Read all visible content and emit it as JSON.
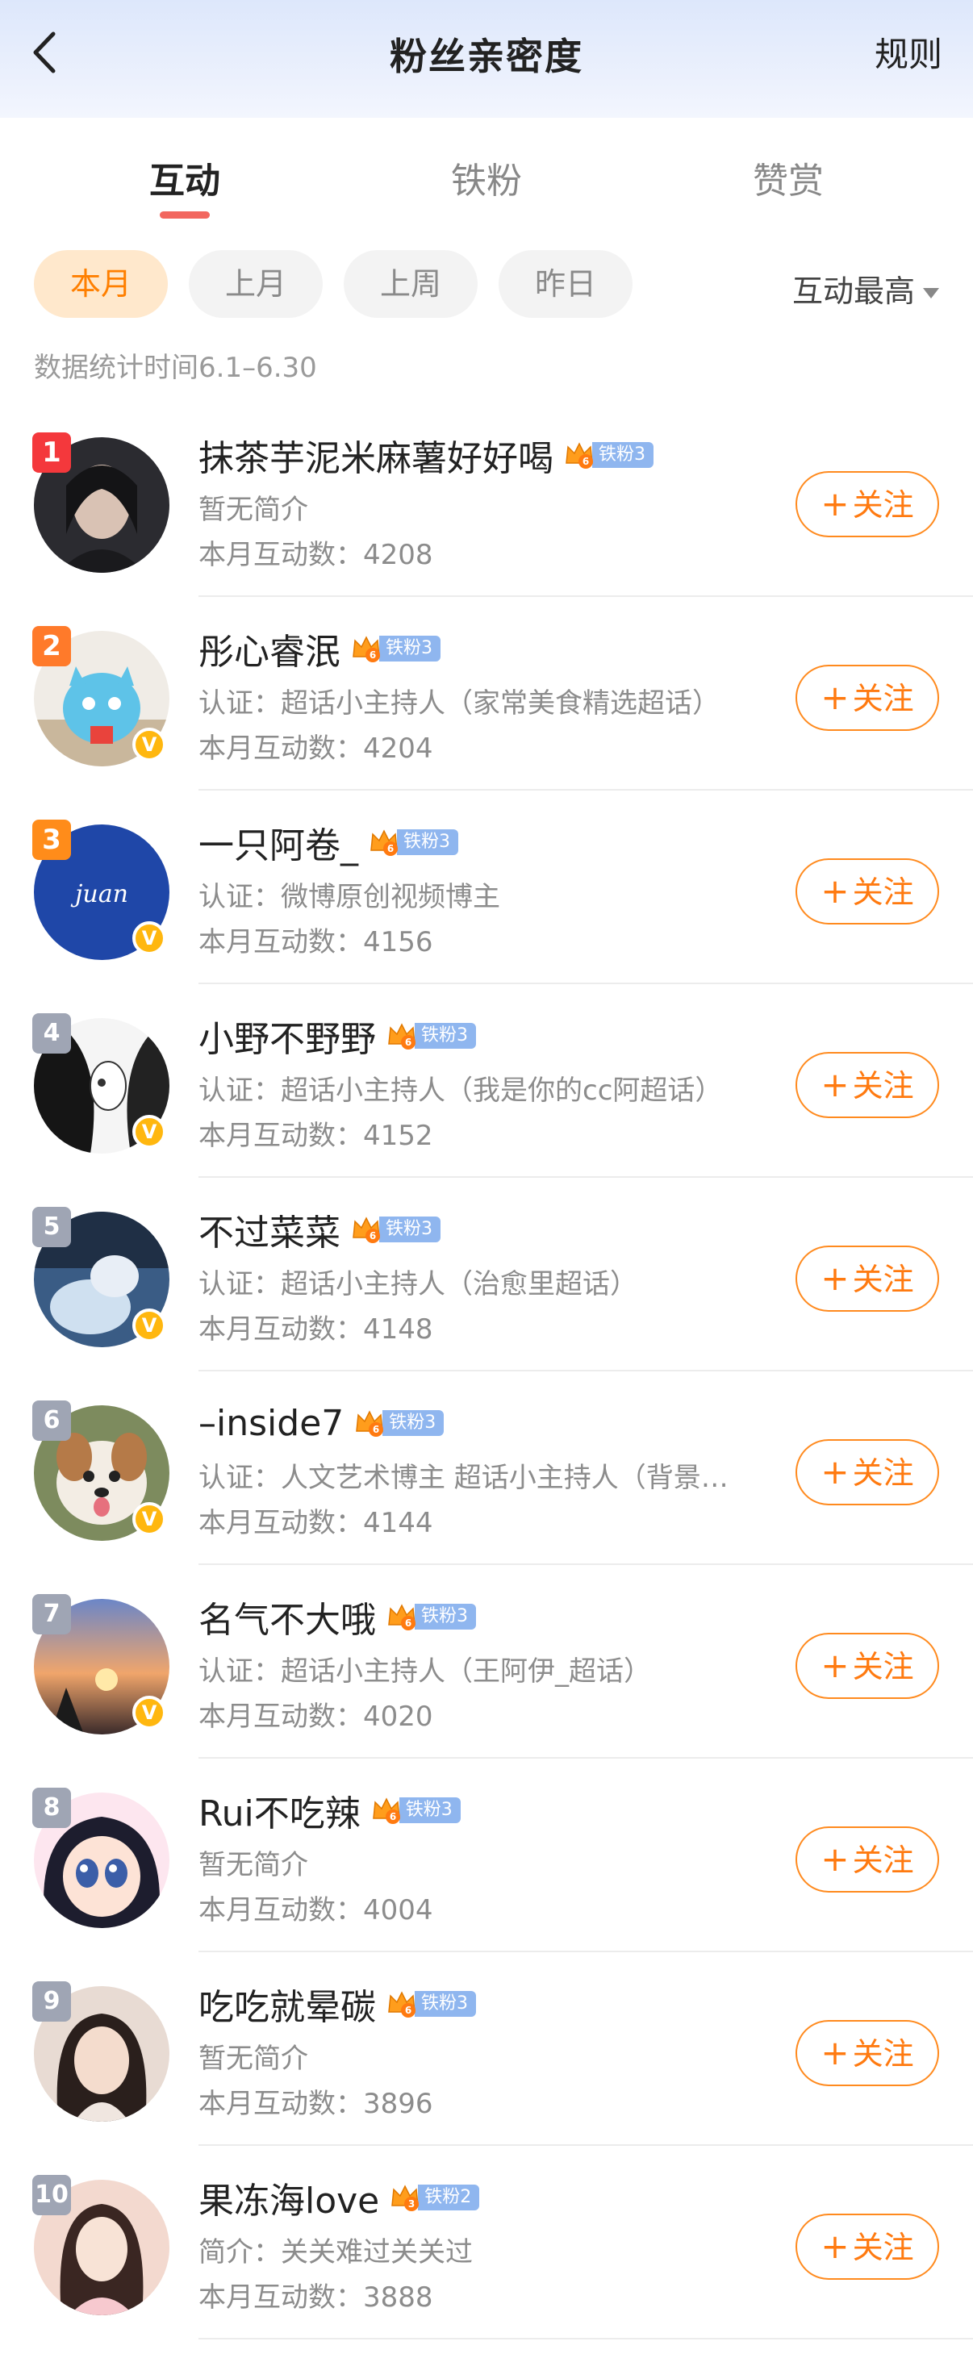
{
  "header": {
    "title": "粉丝亲密度",
    "rules_label": "规则"
  },
  "tabs": [
    {
      "label": "互动",
      "active": true
    },
    {
      "label": "铁粉",
      "active": false
    },
    {
      "label": "赞赏",
      "active": false
    }
  ],
  "filters": {
    "chips": [
      {
        "label": "本月",
        "active": true
      },
      {
        "label": "上月",
        "active": false
      },
      {
        "label": "上周",
        "active": false
      },
      {
        "label": "昨日",
        "active": false
      }
    ],
    "sort_label": "互动最高"
  },
  "date_range": "数据统计时间6.1–6.30",
  "follow_label": "关注",
  "colors": {
    "accent": "#ff7f00",
    "rank_top": "#f4383c",
    "fan_badge": "#8fb6ef",
    "verified": "#ffb70f"
  },
  "fans": [
    {
      "rank": "1",
      "name": "抹茶芋泥米麻薯好好喝",
      "crown_level": "6",
      "fan_badge": "铁粉3",
      "desc": "暂无简介",
      "count": "本月互动数：4208",
      "verified": false
    },
    {
      "rank": "2",
      "name": "彤心睿泯",
      "crown_level": "6",
      "fan_badge": "铁粉3",
      "desc": "认证：超话小主持人（家常美食精选超话）",
      "count": "本月互动数：4204",
      "verified": true
    },
    {
      "rank": "3",
      "name": "一只阿卷_",
      "crown_level": "6",
      "fan_badge": "铁粉3",
      "desc": "认证：微博原创视频博主",
      "count": "本月互动数：4156",
      "verified": true
    },
    {
      "rank": "4",
      "name": "小野不野野",
      "crown_level": "6",
      "fan_badge": "铁粉3",
      "desc": "认证：超话小主持人（我是你的cc阿超话）",
      "count": "本月互动数：4152",
      "verified": true
    },
    {
      "rank": "5",
      "name": "不过菜菜",
      "crown_level": "6",
      "fan_badge": "铁粉3",
      "desc": "认证：超话小主持人（治愈里超话）",
      "count": "本月互动数：4148",
      "verified": true
    },
    {
      "rank": "6",
      "name": "–inside7",
      "crown_level": "6",
      "fan_badge": "铁粉3",
      "desc": "认证：人文艺术博主 超话小主持人（背景…",
      "count": "本月互动数：4144",
      "verified": true
    },
    {
      "rank": "7",
      "name": "名气不大哦",
      "crown_level": "6",
      "fan_badge": "铁粉3",
      "desc": "认证：超话小主持人（王阿伊_超话）",
      "count": "本月互动数：4020",
      "verified": true
    },
    {
      "rank": "8",
      "name": "Rui不吃辣",
      "crown_level": "6",
      "fan_badge": "铁粉3",
      "desc": "暂无简介",
      "count": "本月互动数：4004",
      "verified": false
    },
    {
      "rank": "9",
      "name": "吃吃就晕碳",
      "crown_level": "6",
      "fan_badge": "铁粉3",
      "desc": "暂无简介",
      "count": "本月互动数：3896",
      "verified": false
    },
    {
      "rank": "10",
      "name": "果冻海love",
      "crown_level": "3",
      "fan_badge": "铁粉2",
      "desc": "简介：关关难过关关过",
      "count": "本月互动数：3888",
      "verified": false
    }
  ]
}
